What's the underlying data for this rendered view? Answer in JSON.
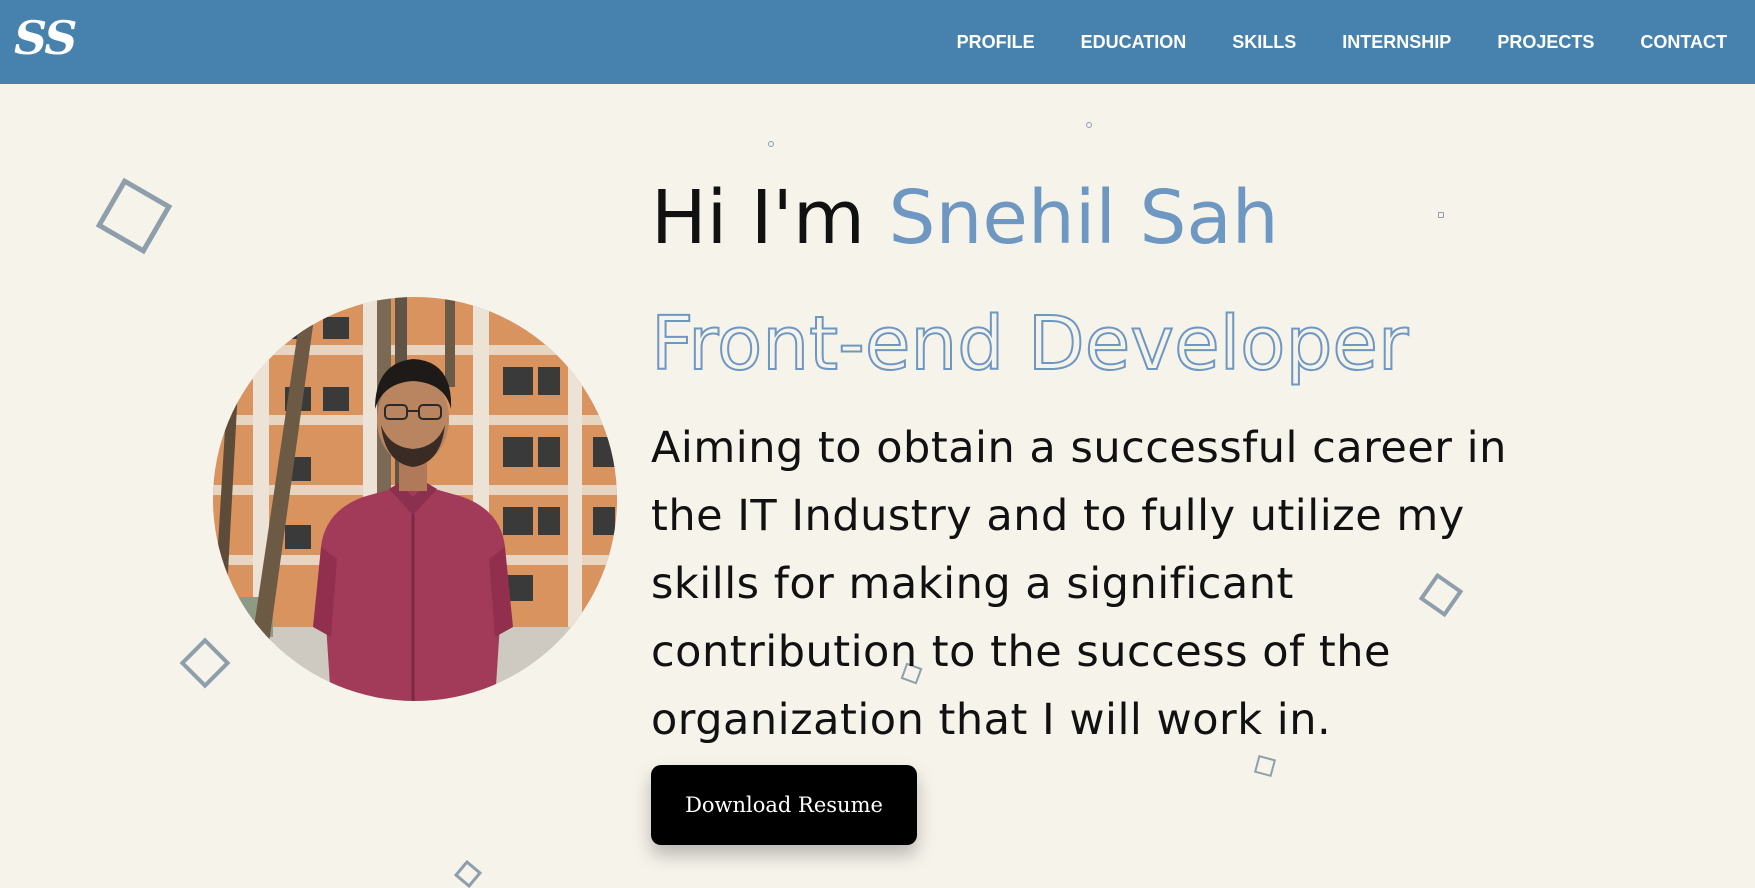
{
  "navbar": {
    "logo": "SS",
    "links": [
      "PROFILE",
      "EDUCATION",
      "SKILLS",
      "INTERNSHIP",
      "PROJECTS",
      "CONTACT"
    ]
  },
  "hero": {
    "greeting_prefix": "Hi I'm ",
    "name": "Snehil Sah",
    "role": "Front-end Developer",
    "objective": "Aiming to obtain a successful career in the IT Industry and to fully utilize my skills for making a significant contribution to the success of the organization that I will work in.",
    "button_label": "Download Resume"
  },
  "colors": {
    "navbar_bg": "#4682ad",
    "page_bg": "#f6f3eb",
    "accent": "#6e97c2",
    "button_bg": "#000000"
  },
  "icons": {
    "logo": "ss-monogram",
    "decorations": "outlined-square-shapes"
  }
}
